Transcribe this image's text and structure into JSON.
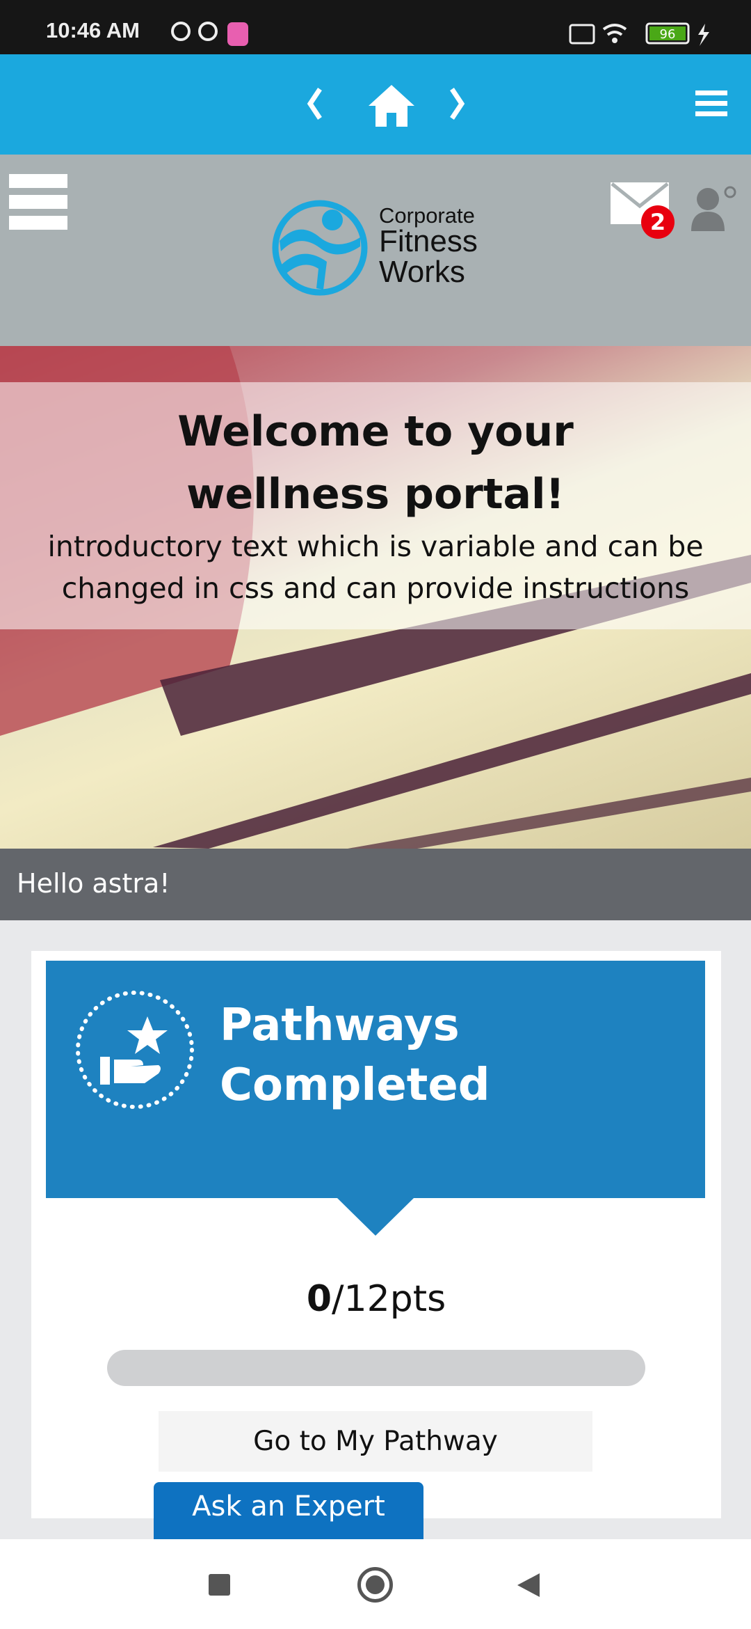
{
  "status_bar": {
    "time": "10:46 AM",
    "battery": "96"
  },
  "top_nav": {
    "back_icon": "chevron-left-icon",
    "home_icon": "home-icon",
    "forward_icon": "chevron-right-icon",
    "menu_icon": "hamburger-icon"
  },
  "header": {
    "logo_lines": [
      "Corporate",
      "Fitness",
      "Works"
    ],
    "mail_badge": "2"
  },
  "hero": {
    "title": "Welcome to your wellness portal!",
    "intro": "introductory text which is variable and can be changed in css and can provide instructions"
  },
  "greeting": "Hello astra!",
  "card": {
    "title_line1": "Pathways",
    "title_line2": "Completed",
    "score": "0",
    "total": "/12pts",
    "progress_percent": 0,
    "button": "Go to My Pathway"
  },
  "ask_expert": "Ask an Expert",
  "colors": {
    "nav": "#1ba8de",
    "header": "#a9b1b3",
    "card_blue": "#1e82c0",
    "badge": "#e8000f"
  }
}
